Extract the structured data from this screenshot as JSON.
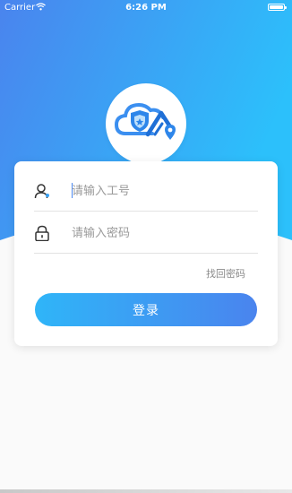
{
  "status_bar": {
    "carrier": "Carrier",
    "time": "6:26 PM"
  },
  "theme": {
    "gradient_start": "#2fb5f8",
    "gradient_end": "#4a84ee",
    "background": "#fafafa"
  },
  "logo": {
    "icon": "cloud-shield-location-logo"
  },
  "login_form": {
    "employee_id": {
      "placeholder": "请输入工号",
      "value": "",
      "icon": "user-icon"
    },
    "password": {
      "placeholder": "请输入密码",
      "value": "",
      "icon": "lock-icon"
    },
    "forgot_password_label": "找回密码",
    "login_button_label": "登录"
  }
}
